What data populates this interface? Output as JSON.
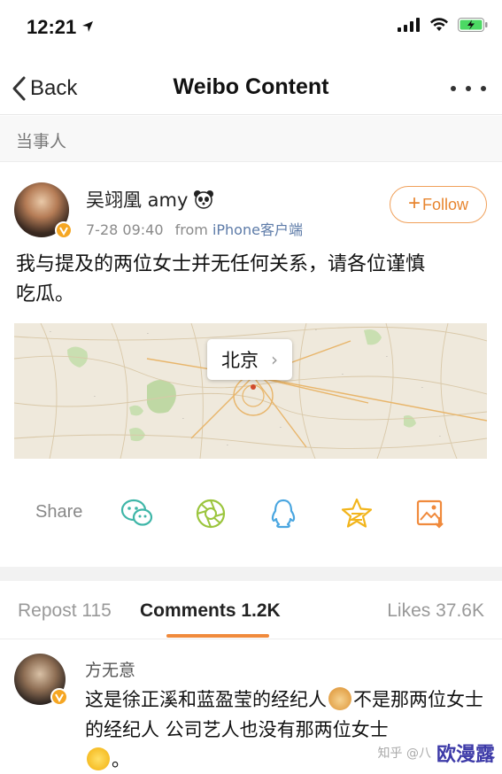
{
  "status_bar": {
    "time": "12:21"
  },
  "nav": {
    "back_label": "Back",
    "title": "Weibo Content"
  },
  "section_header": {
    "label": "当事人"
  },
  "post": {
    "author_name": "吴翊凰 amy",
    "timestamp": "7-28 09:40",
    "from_word": "from",
    "source": "iPhone客户端",
    "follow_label": "Follow",
    "text_line1": "我与提及的两位女士并无任何关系，请各位谨慎",
    "text_line2": "吃瓜。",
    "map_city": "北京"
  },
  "share": {
    "label": "Share",
    "icons": [
      "wechat-icon",
      "moments-icon",
      "qq-icon",
      "qzone-icon",
      "save-image-icon"
    ]
  },
  "tabs": {
    "repost": "Repost 115",
    "comments": "Comments 1.2K",
    "likes": "Likes 37.6K"
  },
  "comment": {
    "author": "方无意",
    "text_part1": "这是徐正溪和蓝盈莹的经纪人",
    "text_part2": "不是那两位女士的经纪人 公司艺人也没有那两位女士",
    "text_part3": "。"
  },
  "watermark": {
    "text": "知乎 @八",
    "brand": "欧漫露"
  },
  "colors": {
    "accent": "#f08a3c",
    "link": "#5d7ba8",
    "verified": "#f5a623",
    "share_icon": "#3fb6a8"
  }
}
